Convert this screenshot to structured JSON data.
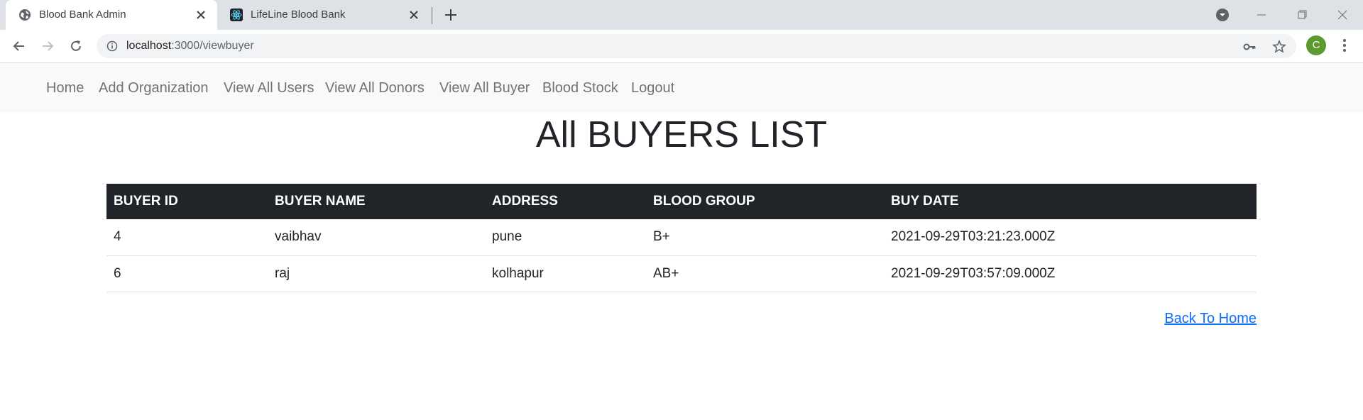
{
  "browser": {
    "tabs": [
      {
        "title": "Blood Bank Admin",
        "active": true
      },
      {
        "title": "LifeLine Blood Bank",
        "active": false
      }
    ],
    "url_host": "localhost",
    "url_path": ":3000/viewbuyer",
    "profile_initial": "C",
    "profile_color": "#5a9a2e"
  },
  "navbar": {
    "links": [
      "Home",
      "Add Organization",
      "View All Users",
      "View All Donors",
      "View All Buyer",
      "Blood Stock",
      "Logout"
    ]
  },
  "main": {
    "title": "All BUYERS LIST",
    "table": {
      "headers": [
        "BUYER ID",
        "BUYER NAME",
        "ADDRESS",
        "BLOOD GROUP",
        "BUY DATE"
      ],
      "rows": [
        [
          "4",
          "vaibhav",
          "pune",
          "B+",
          "2021-09-29T03:21:23.000Z"
        ],
        [
          "6",
          "raj",
          "kolhapur",
          "AB+",
          "2021-09-29T03:57:09.000Z"
        ]
      ]
    },
    "back_link": "Back To Home"
  },
  "colors": {
    "table_header_bg": "#212529",
    "link_blue": "#0d6efd",
    "navbar_bg": "#f8f9fa"
  }
}
